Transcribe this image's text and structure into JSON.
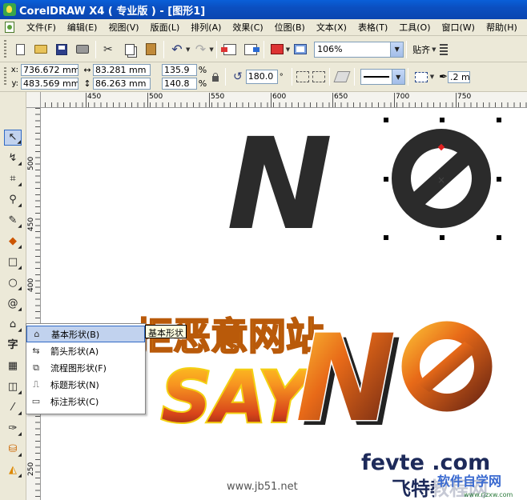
{
  "window": {
    "title": "CorelDRAW X4 ( 专业版 ) - [图形1]"
  },
  "menubar": {
    "items": [
      "文件(F)",
      "编辑(E)",
      "视图(V)",
      "版面(L)",
      "排列(A)",
      "效果(C)",
      "位图(B)",
      "文本(X)",
      "表格(T)",
      "工具(O)",
      "窗口(W)",
      "帮助(H)"
    ]
  },
  "standard_toolbar": {
    "zoom_value": "106%",
    "snap_label": "贴齐"
  },
  "property_bar": {
    "x_label": "x:",
    "y_label": "y:",
    "x_value": "736.672 mm",
    "y_value": "483.569 mm",
    "width_value": "83.281 mm",
    "height_value": "86.263 mm",
    "scale_x": "135.9",
    "scale_y": "140.8",
    "percent": "%",
    "rotation_value": "180.0",
    "degree_symbol": "°",
    "outline_width": ".2 mm"
  },
  "rulers": {
    "horizontal": [
      "450",
      "500",
      "550",
      "600",
      "650",
      "700",
      "750"
    ],
    "vertical": [
      "500",
      "450",
      "400",
      "250"
    ]
  },
  "flyout": {
    "items": [
      "基本形状(B)",
      "箭头形状(A)",
      "流程图形状(F)",
      "标题形状(N)",
      "标注形状(C)"
    ],
    "tooltip": "基本形状"
  },
  "artwork": {
    "top_text": "N",
    "bottom_chinese": "拒恶意网站",
    "bottom_say": "SAY",
    "bottom_no": "N",
    "site_latin": "fevte .com",
    "site_chinese": "飞特教程网",
    "badge_text": "软件自学网",
    "badge_url": "www.rjzxw.com"
  },
  "watermark": "www.jb51.net",
  "colors": {
    "title_bar": "#0a5fd8",
    "shape_fill": "#2b2b2b",
    "fire_orange": "#f07a1a",
    "flame_gold": "#ffd21f",
    "selection_node": "#e02020"
  }
}
